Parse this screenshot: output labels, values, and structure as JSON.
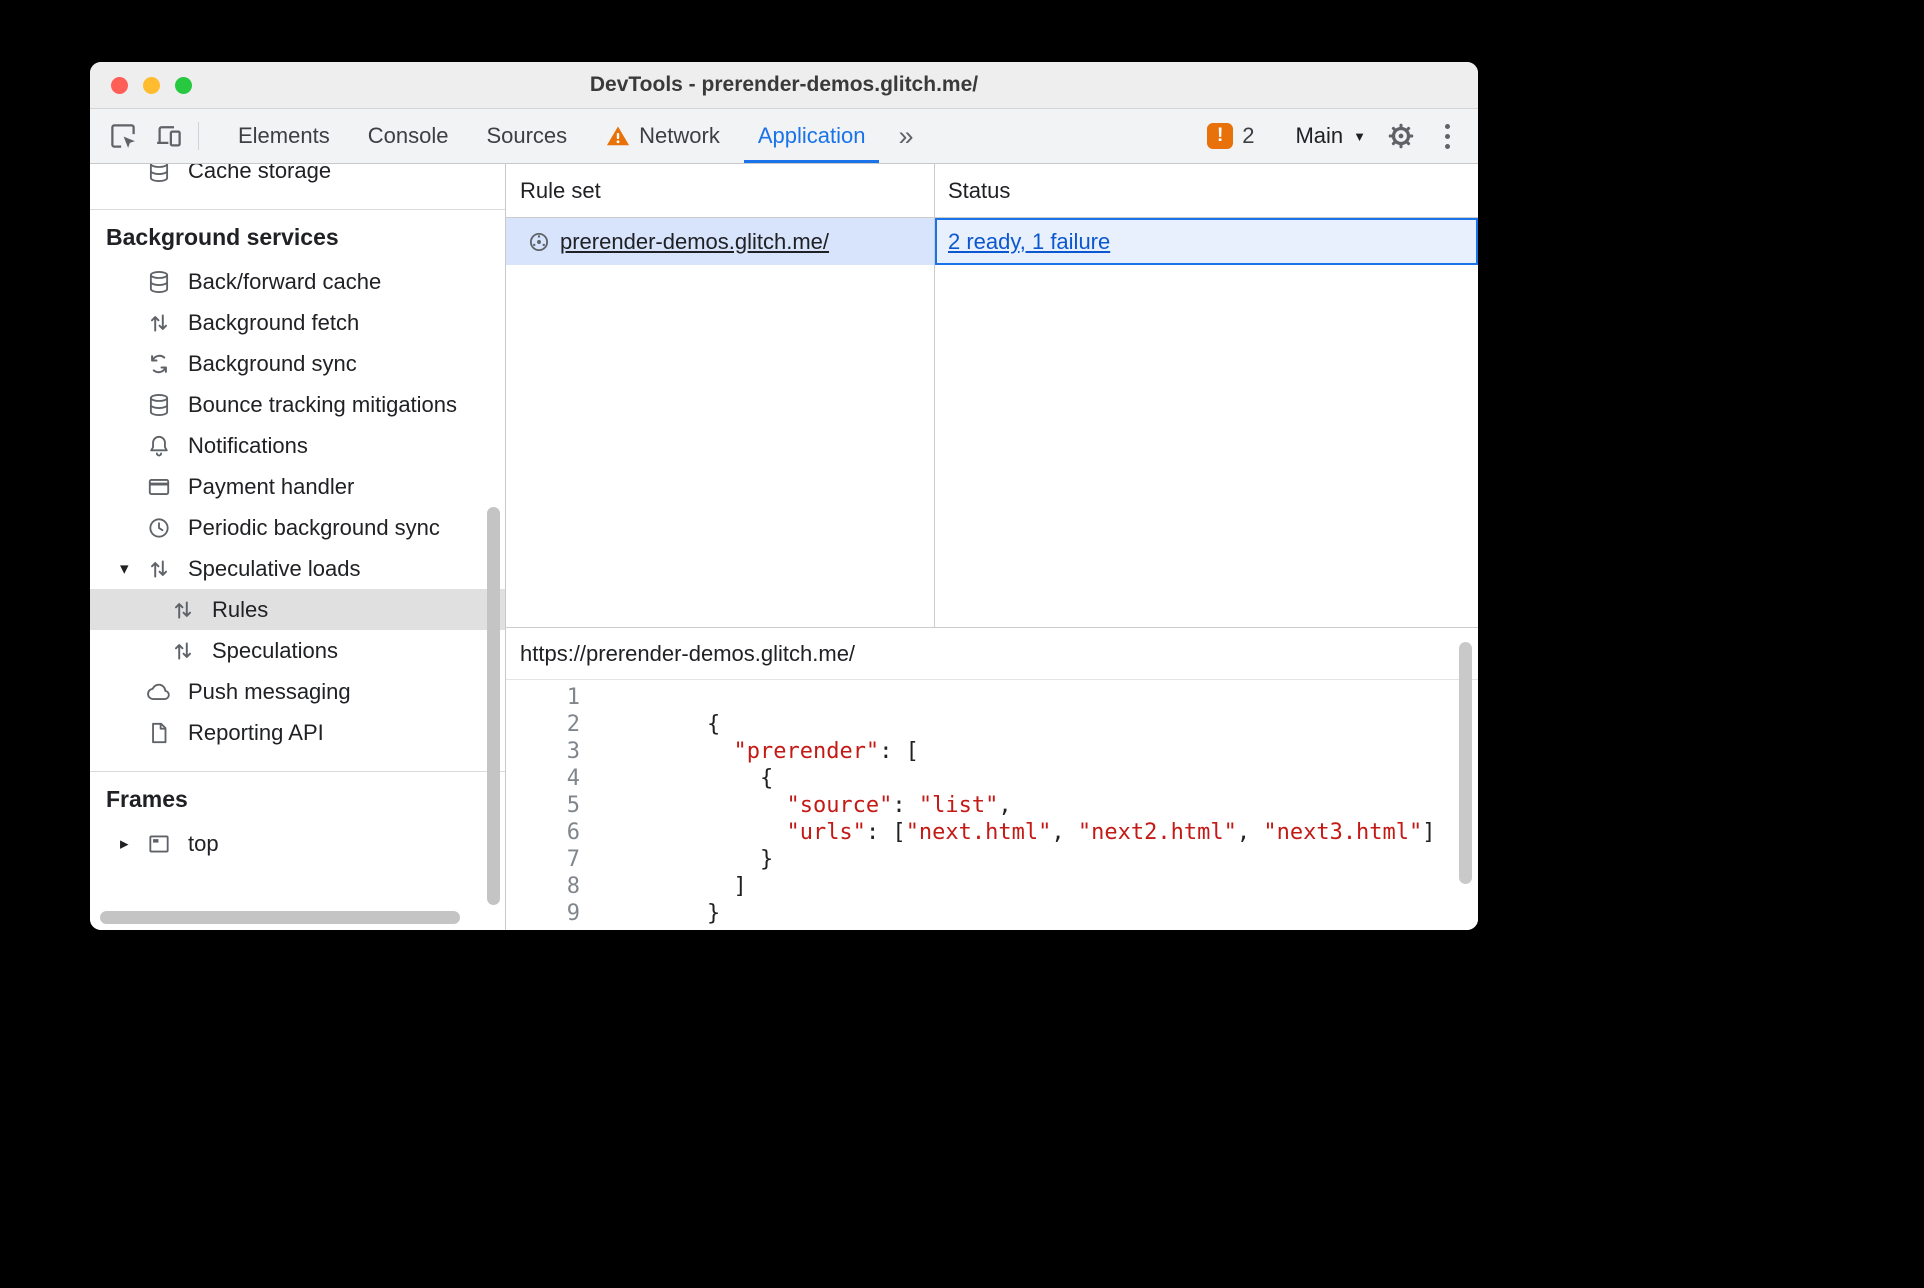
{
  "colors": {
    "accent_blue": "#1a73e8",
    "link_blue": "#0b57d0",
    "string_red": "#c41a16",
    "badge_orange": "#e8710a",
    "selected_row_bg": "#d7e4fc",
    "selected_cell_bg": "#e9f0fd",
    "sidebar_selected_bg": "#e0e0e0"
  },
  "window": {
    "title": "DevTools - prerender-demos.glitch.me/"
  },
  "toolbar": {
    "left_icons": [
      "inspect-icon",
      "device-toolbar-icon"
    ],
    "tabs": [
      {
        "label": "Elements",
        "active": false
      },
      {
        "label": "Console",
        "active": false
      },
      {
        "label": "Sources",
        "active": false
      },
      {
        "label": "Network",
        "active": false,
        "warning_icon": "warning-icon"
      },
      {
        "label": "Application",
        "active": true
      }
    ],
    "more_tabs": "»",
    "error_badge": {
      "icon": "error-badge-icon",
      "glyph": "!",
      "count": "2"
    },
    "target_selector": {
      "label": "Main",
      "dropdown_icon": "dropdown-arrow-icon"
    },
    "right_icons": [
      "gear-icon",
      "kebab-menu-icon"
    ]
  },
  "sidebar": {
    "clipped_item": {
      "label": "Cache storage",
      "icon": "database-icon"
    },
    "sections": [
      {
        "header": "Background services",
        "items": [
          {
            "label": "Back/forward cache",
            "icon": "database-icon"
          },
          {
            "label": "Background fetch",
            "icon": "updown-arrows-icon"
          },
          {
            "label": "Background sync",
            "icon": "sync-icon"
          },
          {
            "label": "Bounce tracking mitigations",
            "icon": "database-icon"
          },
          {
            "label": "Notifications",
            "icon": "bell-icon"
          },
          {
            "label": "Payment handler",
            "icon": "card-icon"
          },
          {
            "label": "Periodic background sync",
            "icon": "clock-icon"
          },
          {
            "label": "Speculative loads",
            "icon": "updown-arrows-icon",
            "expanded": true,
            "children": [
              {
                "label": "Rules",
                "icon": "updown-arrows-icon",
                "selected": true
              },
              {
                "label": "Speculations",
                "icon": "updown-arrows-icon"
              }
            ]
          },
          {
            "label": "Push messaging",
            "icon": "cloud-icon"
          },
          {
            "label": "Reporting API",
            "icon": "document-icon"
          }
        ]
      },
      {
        "header": "Frames",
        "items": [
          {
            "label": "top",
            "icon": "frame-icon",
            "collapsed": true
          }
        ]
      }
    ]
  },
  "main": {
    "table": {
      "columns": [
        "Rule set",
        "Status"
      ],
      "rows": [
        {
          "icon": "rule-set-icon",
          "rule_set": "prerender-demos.glitch.me/",
          "status": "2 ready, 1 failure"
        }
      ]
    },
    "detail": {
      "url": "https://prerender-demos.glitch.me/",
      "code_lines": [
        {
          "num": 1,
          "tokens": []
        },
        {
          "num": 2,
          "tokens": [
            [
              "p",
              "    {"
            ]
          ]
        },
        {
          "num": 3,
          "tokens": [
            [
              "p",
              "      "
            ],
            [
              "s",
              "\"prerender\""
            ],
            [
              "p",
              ": ["
            ]
          ]
        },
        {
          "num": 4,
          "tokens": [
            [
              "p",
              "        {"
            ]
          ]
        },
        {
          "num": 5,
          "tokens": [
            [
              "p",
              "          "
            ],
            [
              "s",
              "\"source\""
            ],
            [
              "p",
              ": "
            ],
            [
              "s",
              "\"list\""
            ],
            [
              "p",
              ","
            ]
          ]
        },
        {
          "num": 6,
          "tokens": [
            [
              "p",
              "          "
            ],
            [
              "s",
              "\"urls\""
            ],
            [
              "p",
              ": ["
            ],
            [
              "s",
              "\"next.html\""
            ],
            [
              "p",
              ", "
            ],
            [
              "s",
              "\"next2.html\""
            ],
            [
              "p",
              ", "
            ],
            [
              "s",
              "\"next3.html\""
            ],
            [
              "p",
              "]"
            ]
          ]
        },
        {
          "num": 7,
          "tokens": [
            [
              "p",
              "        }"
            ]
          ]
        },
        {
          "num": 8,
          "tokens": [
            [
              "p",
              "      ]"
            ]
          ]
        },
        {
          "num": 9,
          "tokens": [
            [
              "p",
              "    }"
            ]
          ]
        }
      ]
    }
  }
}
